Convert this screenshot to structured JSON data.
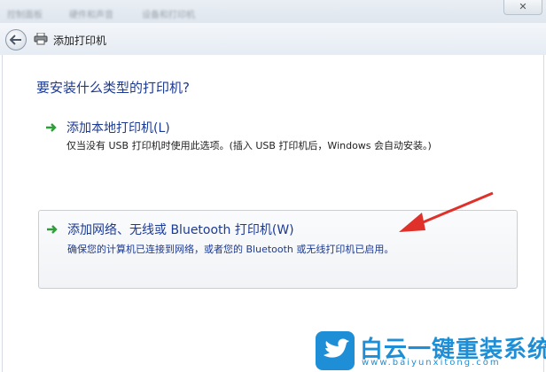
{
  "window": {
    "title": "添加打印机",
    "breadcrumbs": [
      "控制面板",
      "硬件和声音",
      "设备和打印机"
    ],
    "close_label": "✕"
  },
  "heading": "要安装什么类型的打印机?",
  "options": [
    {
      "title": "添加本地打印机(L)",
      "description": "仅当没有 USB 打印机时使用此选项。(插入 USB 打印机后，Windows 会自动安装。)"
    },
    {
      "title": "添加网络、无线或 Bluetooth 打印机(W)",
      "description": "确保您的计算机已连接到网络，或者您的 Bluetooth 或无线打印机已启用。"
    }
  ],
  "colors": {
    "heading": "#1c3a94",
    "arrow_green": "#2e9e3a",
    "annotation_red": "#e0302a",
    "watermark": "#1e8fd6"
  },
  "watermark": {
    "name": "白云一键重装系统",
    "url": "www.baiyunxitong.com"
  },
  "icons": {
    "back": "back-arrow-icon",
    "printer": "printer-icon",
    "option_arrow": "green-arrow-icon",
    "watermark_logo": "bird-logo-icon"
  }
}
